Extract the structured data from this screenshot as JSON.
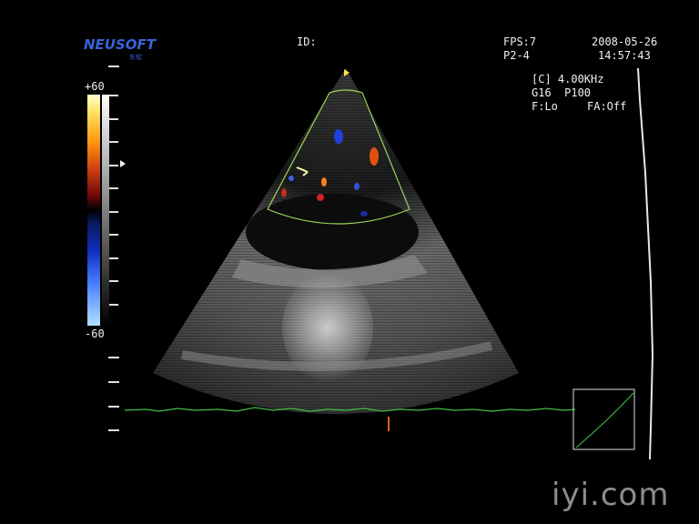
{
  "header": {
    "logo_text": "NEUSOFT",
    "logo_sub": "东软",
    "id_label": "ID:",
    "fps": "FPS:7",
    "probe": "P2-4",
    "date": "2008-05-26",
    "time": "14:57:43"
  },
  "params": {
    "mode_freq": "[C] 4.00KHz",
    "gain_power": "G16  P100",
    "filter": "F:Lo",
    "frame_avg": "FA:Off"
  },
  "color_scale": {
    "max_label": "+60",
    "min_label": "-60"
  },
  "watermark": "iyi.com",
  "colors": {
    "roi_box": "#9cd65a",
    "ecg_trace": "#40c040",
    "logo": "#3a63d9"
  }
}
